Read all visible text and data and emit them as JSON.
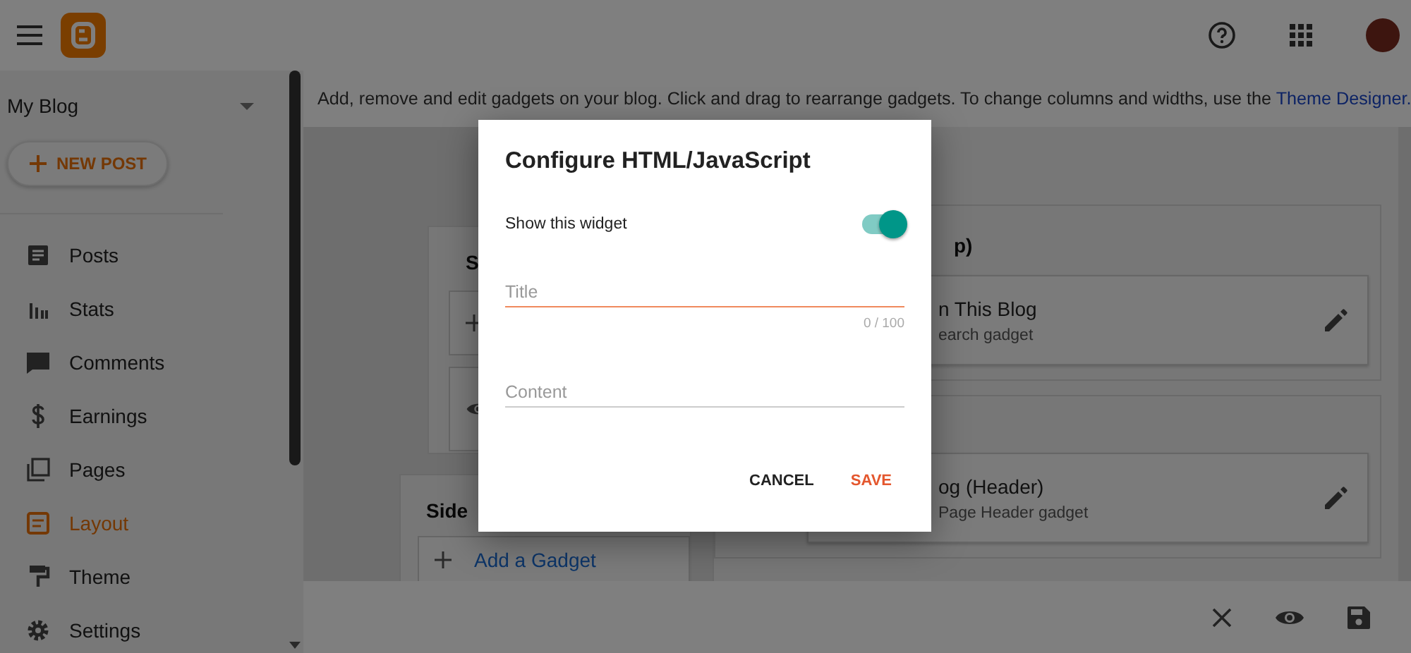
{
  "sidebar": {
    "blog_name": "My Blog",
    "new_post_button": "NEW POST",
    "items": [
      {
        "label": "Posts",
        "selected": false
      },
      {
        "label": "Stats",
        "selected": false
      },
      {
        "label": "Comments",
        "selected": false
      },
      {
        "label": "Earnings",
        "selected": false
      },
      {
        "label": "Pages",
        "selected": false
      },
      {
        "label": "Layout",
        "selected": true
      },
      {
        "label": "Theme",
        "selected": false
      },
      {
        "label": "Settings",
        "selected": false
      }
    ]
  },
  "info_bar": {
    "text": "Add, remove and edit gadgets on your blog. Click and drag to rearrange gadgets. To change columns and widths, use the",
    "link": "Theme Designer."
  },
  "left_sections": [
    {
      "heading": "S",
      "cards": [
        {
          "kind": "add"
        },
        {
          "kind": "eye"
        }
      ]
    },
    {
      "heading": "Side",
      "cards": [
        {
          "kind": "add",
          "label": "Add a Gadget"
        }
      ]
    }
  ],
  "right_sections": [
    {
      "heading": "p)",
      "gadgets": [
        {
          "title": "n This Blog",
          "subtitle": "earch gadget"
        }
      ]
    },
    {
      "gadgets": [
        {
          "title": "og (Header)",
          "subtitle": "Page Header gadget"
        }
      ]
    }
  ],
  "dialog": {
    "title": "Configure HTML/JavaScript",
    "toggle": {
      "label": "Show this widget",
      "on": true
    },
    "fields": [
      {
        "placeholder": "Title",
        "counter": "0 / 100",
        "focused": true
      },
      {
        "placeholder": "Content",
        "focused": false
      }
    ],
    "buttons": [
      {
        "label": "CANCEL",
        "kind": "plain"
      },
      {
        "label": "SAVE",
        "kind": "primary"
      }
    ]
  }
}
